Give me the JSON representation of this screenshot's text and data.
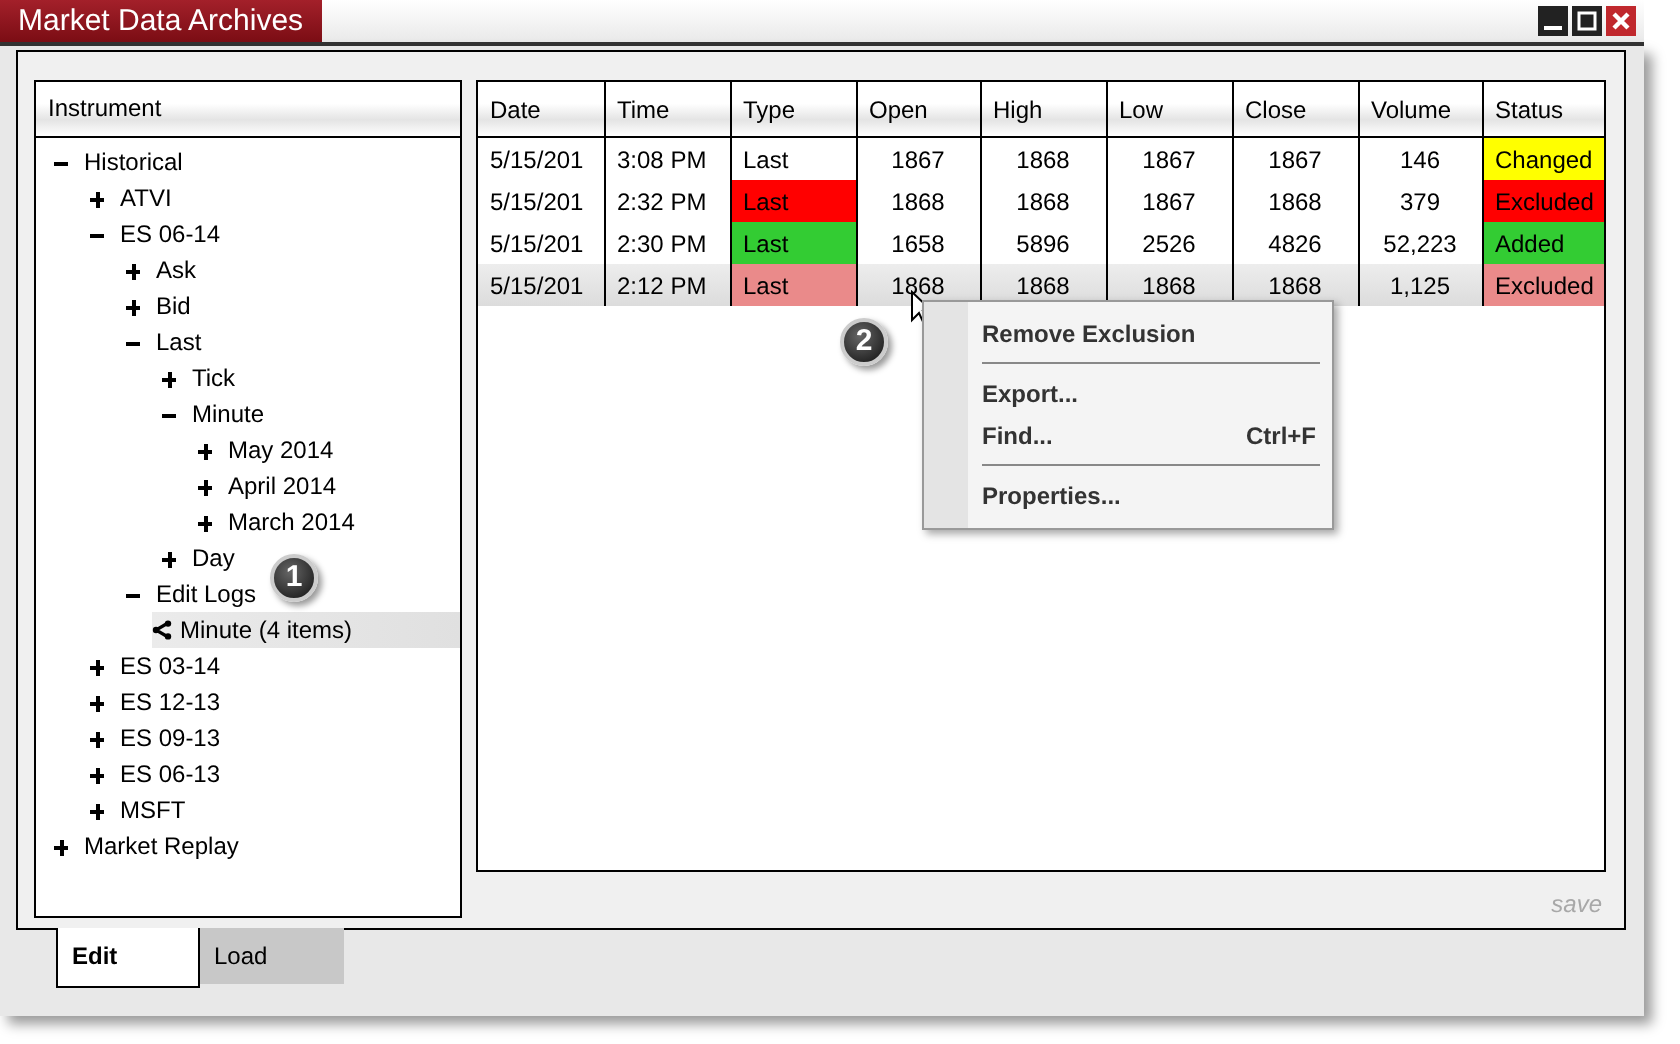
{
  "window": {
    "title": "Market Data Archives"
  },
  "tree": {
    "header": "Instrument",
    "items": [
      {
        "label": "Historical",
        "expanded": true,
        "selected": false,
        "children": [
          {
            "label": "ATVI",
            "expanded": false,
            "selected": false
          },
          {
            "label": "ES 06-14",
            "expanded": true,
            "selected": false,
            "children": [
              {
                "label": "Ask",
                "expanded": false,
                "selected": false
              },
              {
                "label": "Bid",
                "expanded": false,
                "selected": false
              },
              {
                "label": "Last",
                "expanded": true,
                "selected": false,
                "children": [
                  {
                    "label": "Tick",
                    "expanded": false,
                    "selected": false
                  },
                  {
                    "label": "Minute",
                    "expanded": true,
                    "selected": false,
                    "children": [
                      {
                        "label": "May 2014",
                        "expanded": false,
                        "selected": false
                      },
                      {
                        "label": "April 2014",
                        "expanded": false,
                        "selected": false
                      },
                      {
                        "label": "March 2014",
                        "expanded": false,
                        "selected": false
                      }
                    ]
                  },
                  {
                    "label": "Day",
                    "expanded": false,
                    "selected": false
                  }
                ]
              },
              {
                "label": "Edit Logs",
                "expanded": true,
                "selected": false,
                "children": [
                  {
                    "label": "Minute (4 items)",
                    "kind": "log",
                    "selected": true
                  }
                ]
              }
            ]
          },
          {
            "label": "ES 03-14",
            "expanded": false,
            "selected": false
          },
          {
            "label": "ES 12-13",
            "expanded": false,
            "selected": false
          },
          {
            "label": "ES 09-13",
            "expanded": false,
            "selected": false
          },
          {
            "label": "ES 06-13",
            "expanded": false,
            "selected": false
          },
          {
            "label": "MSFT",
            "expanded": false,
            "selected": false
          }
        ]
      },
      {
        "label": "Market Replay",
        "expanded": false,
        "selected": false
      }
    ]
  },
  "table": {
    "columns": [
      "Date",
      "Time",
      "Type",
      "Open",
      "High",
      "Low",
      "Close",
      "Volume",
      "Status"
    ],
    "rows": [
      {
        "selected": false,
        "cells": [
          {
            "text": "5/15/201"
          },
          {
            "text": "3:08 PM"
          },
          {
            "text": "Last"
          },
          {
            "text": "1867"
          },
          {
            "text": "1868"
          },
          {
            "text": "1867"
          },
          {
            "text": "1867"
          },
          {
            "text": "146"
          },
          {
            "text": "Changed",
            "color": "#ffff00"
          }
        ]
      },
      {
        "selected": false,
        "cells": [
          {
            "text": "5/15/201"
          },
          {
            "text": "2:32 PM"
          },
          {
            "text": "Last",
            "color": "#ff0000"
          },
          {
            "text": "1868"
          },
          {
            "text": "1868"
          },
          {
            "text": "1867"
          },
          {
            "text": "1868"
          },
          {
            "text": "379"
          },
          {
            "text": "Excluded",
            "color": "#ff0000"
          }
        ]
      },
      {
        "selected": false,
        "cells": [
          {
            "text": "5/15/201"
          },
          {
            "text": "2:30 PM"
          },
          {
            "text": "Last",
            "color": "#33cc33"
          },
          {
            "text": "1658"
          },
          {
            "text": "5896"
          },
          {
            "text": "2526"
          },
          {
            "text": "4826"
          },
          {
            "text": "52,223"
          },
          {
            "text": "Added",
            "color": "#33cc33"
          }
        ]
      },
      {
        "selected": true,
        "cells": [
          {
            "text": "5/15/201"
          },
          {
            "text": "2:12 PM"
          },
          {
            "text": "Last",
            "color": "#ea8a8a"
          },
          {
            "text": "1868"
          },
          {
            "text": "1868"
          },
          {
            "text": "1868"
          },
          {
            "text": "1868"
          },
          {
            "text": "1,125"
          },
          {
            "text": "Excluded",
            "color": "#ea8a8a"
          }
        ]
      }
    ]
  },
  "save_link": "save",
  "context_menu": [
    {
      "kind": "item",
      "label": "Remove Exclusion"
    },
    {
      "kind": "separator"
    },
    {
      "kind": "item",
      "label": "Export..."
    },
    {
      "kind": "item",
      "label": "Find...",
      "shortcut": "Ctrl+F"
    },
    {
      "kind": "separator"
    },
    {
      "kind": "item",
      "label": "Properties..."
    }
  ],
  "tabs": [
    {
      "label": "Edit",
      "selected": true
    },
    {
      "label": "Load",
      "selected": false
    }
  ],
  "callouts": [
    {
      "label": "1"
    },
    {
      "label": "2"
    }
  ]
}
